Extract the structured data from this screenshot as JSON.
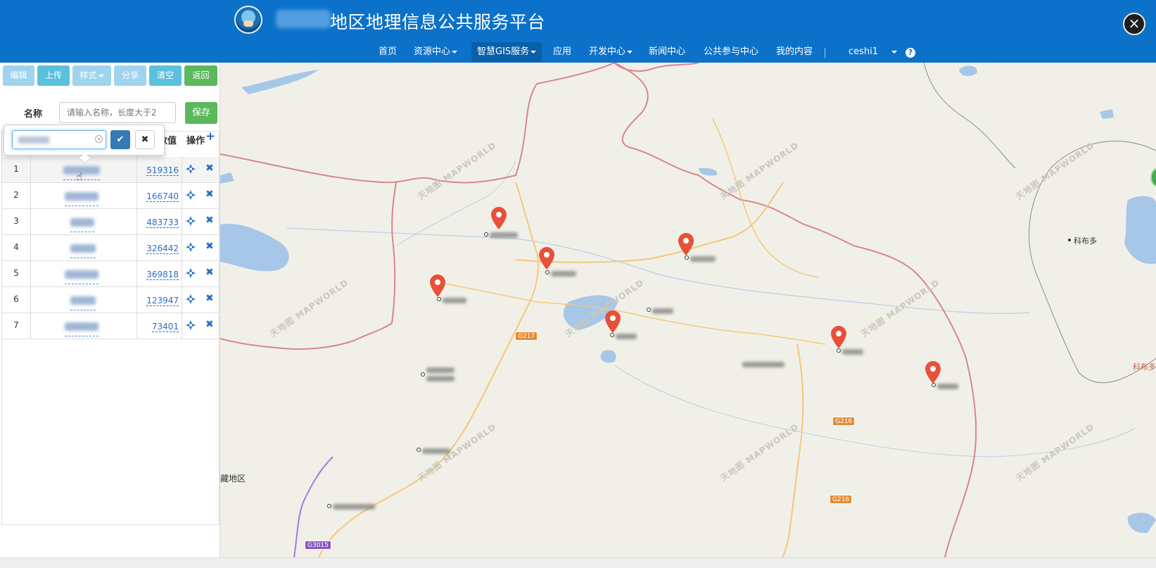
{
  "header": {
    "title": "地区地理信息公共服务平台",
    "close_icon": "close-icon",
    "nav": [
      {
        "label": "首页",
        "has_caret": false
      },
      {
        "label": "资源中心",
        "has_caret": true
      },
      {
        "label": "智慧GIS服务",
        "has_caret": true,
        "active": true
      },
      {
        "label": "应用",
        "has_caret": false
      },
      {
        "label": "开发中心",
        "has_caret": true
      },
      {
        "label": "新闻中心",
        "has_caret": false
      },
      {
        "label": "公共参与中心",
        "has_caret": false
      },
      {
        "label": "我的内容",
        "has_caret": false
      }
    ],
    "user": "ceshi1",
    "help_icon": "?"
  },
  "sidebar": {
    "toolbar": {
      "edit": "编辑",
      "upload": "上传",
      "style": "样式",
      "share": "分享",
      "clear": "清空",
      "back": "返回"
    },
    "name_label": "名称",
    "name_placeholder": "请输入名称，长度大于2",
    "save": "保存",
    "table": {
      "headers": {
        "value": "数值",
        "actions": "操作"
      },
      "rows": [
        {
          "index": "1",
          "value": "519316"
        },
        {
          "index": "2",
          "value": "166740"
        },
        {
          "index": "3",
          "value": "483733"
        },
        {
          "index": "4",
          "value": "326442"
        },
        {
          "index": "5",
          "value": "369818"
        },
        {
          "index": "6",
          "value": "123947"
        },
        {
          "index": "7",
          "value": "73401"
        }
      ]
    },
    "popover": {
      "ok_icon": "✔",
      "cancel_icon": "✖",
      "clear_icon": "×"
    }
  },
  "map": {
    "labels": {
      "region_left": "藏地区",
      "keboduo": "科布多",
      "keboduo_right": "科布多"
    },
    "roads": [
      "G217",
      "G216",
      "G216",
      "G3015"
    ],
    "watermark": "天地图 MAPWORLD",
    "colors": {
      "border": "#d7868c",
      "road": "#f4c77b",
      "water": "#a6c7e8",
      "marker": "#e8503a"
    }
  }
}
